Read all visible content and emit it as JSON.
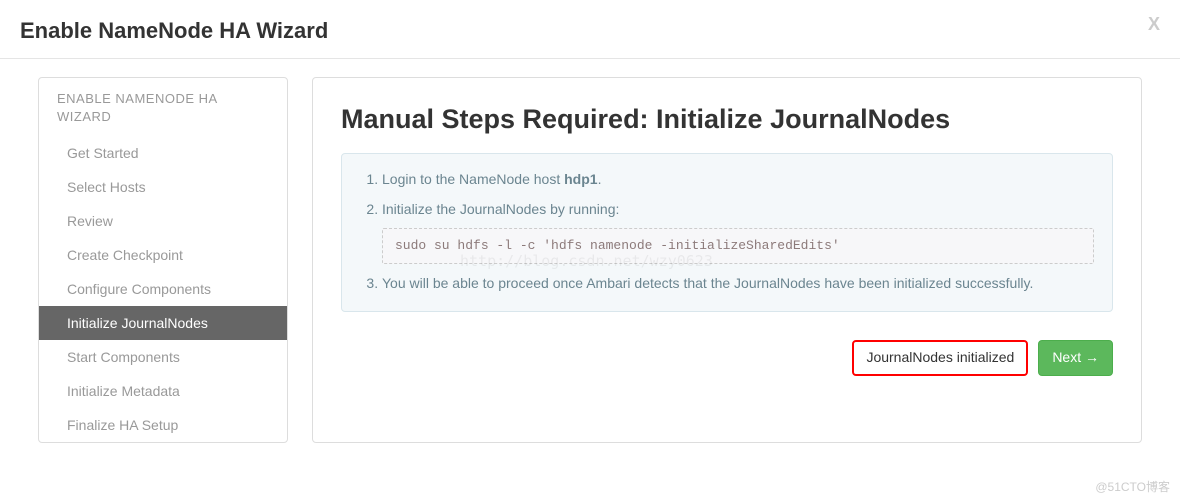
{
  "header": {
    "title": "Enable NameNode HA Wizard",
    "close_label": "X"
  },
  "sidebar": {
    "title": "ENABLE NAMENODE HA WIZARD",
    "items": [
      {
        "label": "Get Started"
      },
      {
        "label": "Select Hosts"
      },
      {
        "label": "Review"
      },
      {
        "label": "Create Checkpoint"
      },
      {
        "label": "Configure Components"
      },
      {
        "label": "Initialize JournalNodes"
      },
      {
        "label": "Start Components"
      },
      {
        "label": "Initialize Metadata"
      },
      {
        "label": "Finalize HA Setup"
      }
    ],
    "active_index": 5
  },
  "main": {
    "heading": "Manual Steps Required: Initialize JournalNodes",
    "steps": {
      "s1_prefix": "Login to the NameNode host ",
      "s1_host": "hdp1",
      "s1_suffix": ".",
      "s2": "Initialize the JournalNodes by running:",
      "s2_cmd": "sudo su hdfs -l -c 'hdfs namenode -initializeSharedEdits'",
      "s3": "You will be able to proceed once Ambari detects that the JournalNodes have been initialized successfully."
    },
    "status_label": "JournalNodes initialized",
    "next_label": "Next →"
  },
  "watermark": "@51CTO博客",
  "faint_watermark": "http://blog.csdn.net/wzy0623"
}
